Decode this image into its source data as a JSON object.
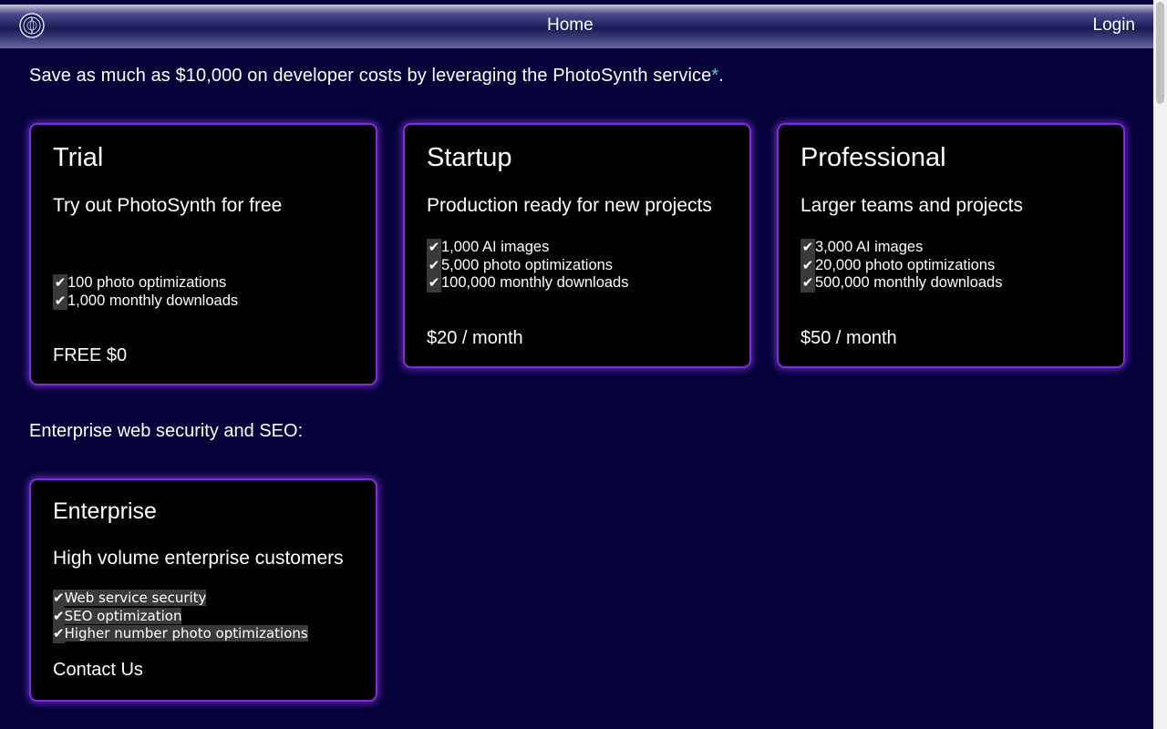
{
  "nav": {
    "home": "Home",
    "login": "Login"
  },
  "intro": {
    "text": "Save as much as $10,000 on developer costs by leveraging the PhotoSynth service",
    "asterisk": "*",
    "period": "."
  },
  "plans": [
    {
      "title": "Trial",
      "subtitle": "Try out PhotoSynth for free",
      "features": [
        "100 photo optimizations",
        "1,000 monthly downloads"
      ],
      "price": "FREE $0"
    },
    {
      "title": "Startup",
      "subtitle": "Production ready for new projects",
      "features": [
        "1,000 AI images",
        "5,000 photo optimizations",
        "100,000 monthly downloads"
      ],
      "price": "$20 / month"
    },
    {
      "title": "Professional",
      "subtitle": "Larger teams and projects",
      "features": [
        "3,000 AI images",
        "20,000 photo optimizations",
        "500,000 monthly downloads"
      ],
      "price": "$50 / month"
    }
  ],
  "enterprise": {
    "section_label": "Enterprise web security and SEO:",
    "title": "Enterprise",
    "subtitle": "High volume enterprise customers",
    "features": [
      "Web service security",
      "SEO optimization",
      "Higher number photo optimizations"
    ],
    "cta": "Contact Us"
  },
  "check_glyph": "✔",
  "colors": {
    "background": "#05023a",
    "card_border": "#7b2fd6",
    "asterisk": "#4fd3d9"
  }
}
